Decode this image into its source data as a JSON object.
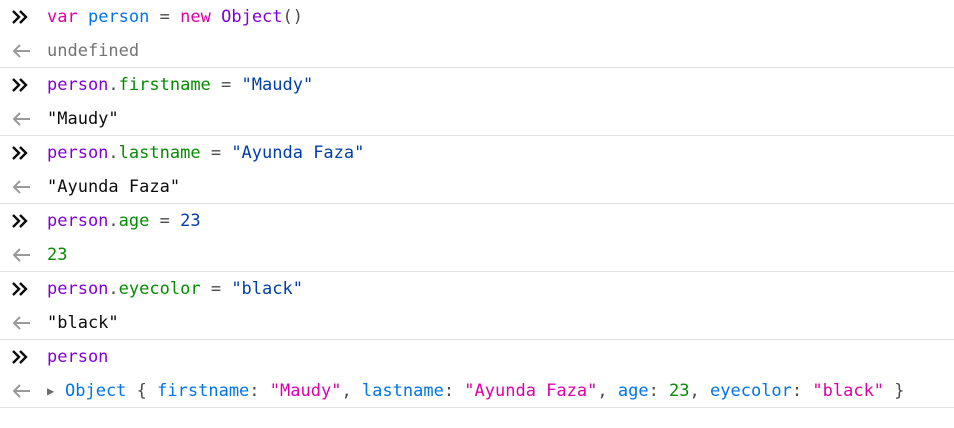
{
  "entries": [
    {
      "input": {
        "kw1": "var",
        "name": "person",
        "eq": "=",
        "kw2": "new",
        "cls": "Object",
        "parens": "()"
      },
      "output": {
        "text": "undefined"
      }
    },
    {
      "input": {
        "obj": "person",
        "dot": ".",
        "prop": "firstname",
        "eq": "=",
        "val": "\"Maudy\""
      },
      "output": {
        "text": "\"Maudy\""
      }
    },
    {
      "input": {
        "obj": "person",
        "dot": ".",
        "prop": "lastname",
        "eq": "=",
        "val": "\"Ayunda Faza\""
      },
      "output": {
        "text": "\"Ayunda Faza\""
      }
    },
    {
      "input": {
        "obj": "person",
        "dot": ".",
        "prop": "age",
        "eq": "=",
        "val": "23"
      },
      "output": {
        "text": "23"
      }
    },
    {
      "input": {
        "obj": "person",
        "dot": ".",
        "prop": "eyecolor",
        "eq": "=",
        "val": "\"black\""
      },
      "output": {
        "text": "\"black\""
      }
    },
    {
      "input": {
        "text": "person"
      },
      "output": {
        "type": "Object",
        "open": "{",
        "close": "}",
        "props": [
          {
            "key": "firstname",
            "val": "\"Maudy\""
          },
          {
            "key": "lastname",
            "val": "\"Ayunda Faza\""
          },
          {
            "key": "age",
            "val": "23"
          },
          {
            "key": "eyecolor",
            "val": "\"black\""
          }
        ]
      }
    }
  ],
  "icons": {
    "input": "prompt-chevron-icon",
    "output": "result-arrow-icon",
    "expand": "expand-triangle-icon"
  }
}
